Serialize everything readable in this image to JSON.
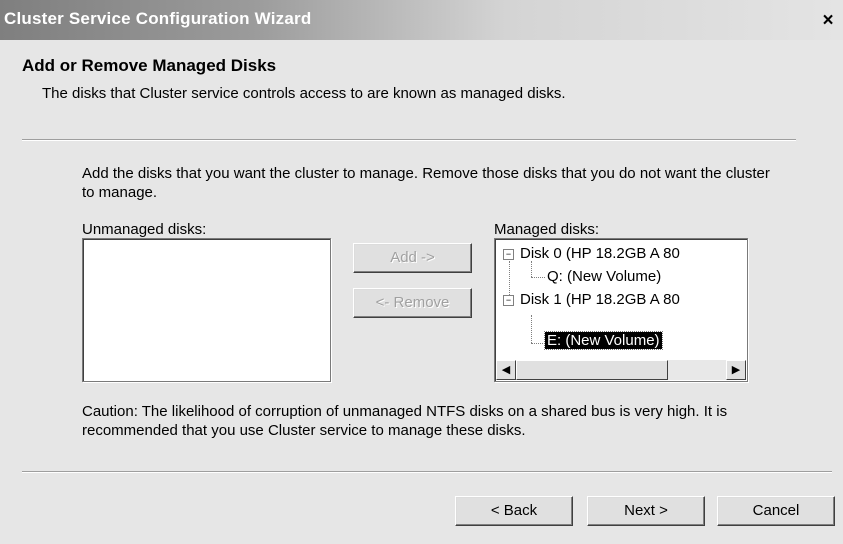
{
  "window": {
    "title": "Cluster Service Configuration Wizard",
    "close_label": "×"
  },
  "header": {
    "title": "Add or Remove Managed Disks",
    "subtitle": "The disks that Cluster service controls access to are known as managed disks."
  },
  "instructions": "Add the disks that you want the cluster to manage. Remove those disks that you do not want the cluster to manage.",
  "unmanaged": {
    "label": "Unmanaged disks:",
    "items": []
  },
  "managed": {
    "label": "Managed disks:",
    "tree": [
      {
        "label": "Disk 0 (HP    18.2GB A 80",
        "expander": "−"
      },
      {
        "label": "Q: (New Volume)"
      },
      {
        "label": "Disk 1 (HP    18.2GB A 80",
        "expander": "−"
      },
      {
        "label": "E: (New Volume)",
        "selected": true
      }
    ]
  },
  "buttons": {
    "add": "Add ->",
    "remove": "<- Remove",
    "back": "< Back",
    "next": "Next >",
    "cancel": "Cancel"
  },
  "scrollbar": {
    "left_arrow": "◀",
    "right_arrow": "▶"
  },
  "caution": "Caution: The likelihood of corruption of unmanaged NTFS disks on a shared bus is very high. It is recommended that you use Cluster service to manage these disks."
}
